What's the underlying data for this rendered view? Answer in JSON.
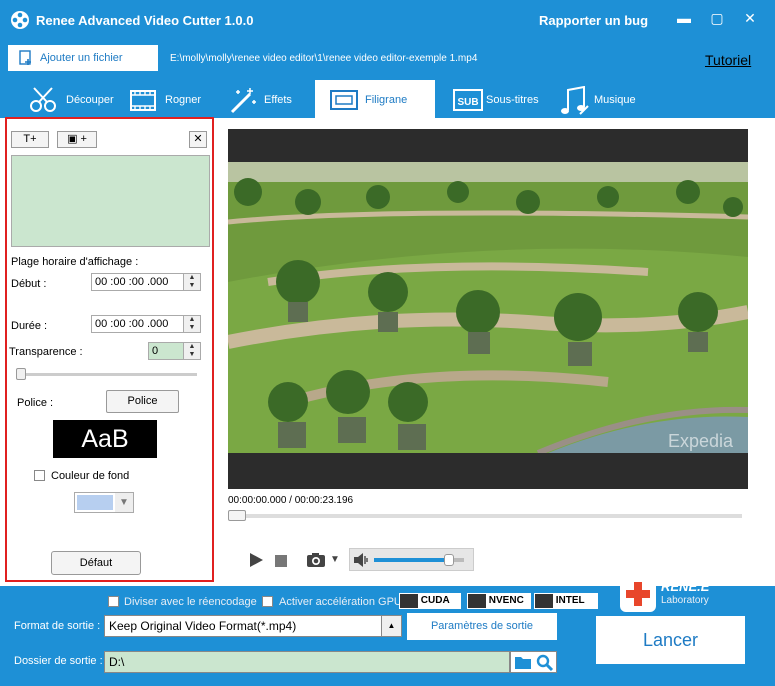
{
  "app": {
    "title": "Renee Advanced Video Cutter 1.0.0",
    "report_bug": "Rapporter un bug"
  },
  "file": {
    "add_label": "Ajouter un fichier",
    "path": "E:\\molly\\molly\\renee video editor\\1\\renee video editor-exemple 1.mp4",
    "tutorial": "Tutoriel"
  },
  "tabs": [
    {
      "label": "Découper",
      "icon": "scissors-icon"
    },
    {
      "label": "Rogner",
      "icon": "crop-icon"
    },
    {
      "label": "Effets",
      "icon": "magic-wand-icon"
    },
    {
      "label": "Filigrane",
      "icon": "watermark-icon",
      "active": true
    },
    {
      "label": "Sous-titres",
      "icon": "subtitle-icon"
    },
    {
      "label": "Musique",
      "icon": "music-icon"
    }
  ],
  "watermark": {
    "add_text": "T+",
    "add_image": "▣ +",
    "close": "✕",
    "range_label": "Plage horaire d'affichage :",
    "start_label": "Début :",
    "start_value": "00 :00 :00 .000",
    "duration_label": "Durée :",
    "duration_value": "00 :00 :00 .000",
    "transparency_label": "Transparence :",
    "transparency_value": "0",
    "font_label": "Police :",
    "font_button": "Police",
    "font_preview": "AaB",
    "bg_color_label": "Couleur de fond",
    "bg_color_value": "#b7cff0",
    "default_button": "Défaut"
  },
  "player": {
    "time": "00:00:00.000 / 00:00:23.196",
    "watermark_text": "Expedia",
    "volume_level": 0.83
  },
  "bottom": {
    "split_label": "Diviser avec le réencodage",
    "gpu_label": "Activer accélération GPU",
    "gpu_options": [
      "CUDA",
      "NVENC",
      "INTEL"
    ],
    "format_label": "Format de sortie :",
    "format_value": "Keep Original Video Format(*.mp4)",
    "params_button": "Paramètres de sortie",
    "folder_label": "Dossier de sortie :",
    "folder_value": "D:\\",
    "launch": "Lancer",
    "logo_top": "RENE.E",
    "logo_bottom": "Laboratory"
  },
  "colors": {
    "accent": "#1e90d6",
    "highlight": "#e02020"
  }
}
